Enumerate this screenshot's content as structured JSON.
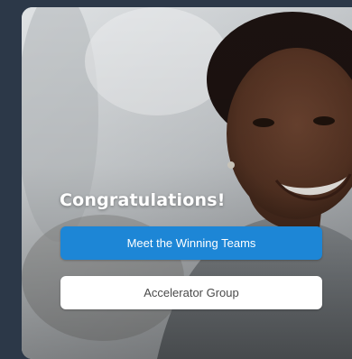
{
  "hero": {
    "headline": "Congratulations!",
    "primary_button_label": "Meet the Winning Teams",
    "secondary_button_label": "Accelerator Group"
  },
  "colors": {
    "page_background": "#2c3848",
    "primary_button": "#1d86d6",
    "secondary_button": "#ffffff"
  }
}
